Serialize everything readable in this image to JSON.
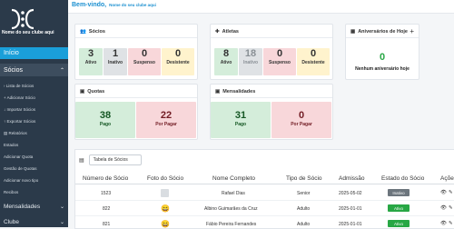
{
  "app": {
    "club_name": "Nome do seu clube aqui"
  },
  "sidebar": {
    "inicio": "Início",
    "socios": "Sócios",
    "socios_sub": [
      "Lista de Sócios",
      "Adicionar Sócio",
      "Importar Sócios",
      "Exportar Sócios",
      "Relatórios",
      "Estados",
      "Adicionar Quota",
      "Gestão de Quotas",
      "Adicionar novo tipo",
      "Recibos"
    ],
    "mensalidades": "Mensalidades",
    "clube": "Clube"
  },
  "header": {
    "welcome": "Bem-vindo,",
    "club": "Nome do seu clube aqui"
  },
  "socios_card": {
    "title": "Sócios",
    "stats": [
      {
        "value": "3",
        "label": "Ativo",
        "color": "#d4edda"
      },
      {
        "value": "1",
        "label": "Inativo",
        "color": "#dfe2e5"
      },
      {
        "value": "0",
        "label": "Suspenso",
        "color": "#f8d7da"
      },
      {
        "value": "0",
        "label": "Desistente",
        "color": "#fff3cd"
      }
    ]
  },
  "atletas_card": {
    "title": "Atletas",
    "stats": [
      {
        "value": "8",
        "label": "Ativo",
        "color": "#d4edda"
      },
      {
        "value": "18",
        "label": "Inativo",
        "color": "#dfe2e5"
      },
      {
        "value": "0",
        "label": "Suspenso",
        "color": "#f8d7da"
      },
      {
        "value": "0",
        "label": "Desistente",
        "color": "#fff3cd"
      }
    ]
  },
  "aniversarios_card": {
    "title": "Aniversários de Hoje",
    "count": "0",
    "text": "Nenhum aniversário hoje"
  },
  "quotas_card": {
    "title": "Quotas",
    "pago_value": "38",
    "pago_label": "Pago",
    "porpagar_value": "22",
    "porpagar_label": "Por Pagar"
  },
  "mensalidades_card": {
    "title": "Mensalidades",
    "pago_value": "31",
    "pago_label": "Pago",
    "porpagar_value": "0",
    "porpagar_label": "Por Pagar"
  },
  "table": {
    "select_value": "Tabela de Sócios",
    "headers": [
      "Número de Sócio",
      "Foto do Sócio",
      "Nome Completo",
      "Tipo de Sócio",
      "Admissão",
      "Estado do Sócio",
      "Açõe"
    ],
    "rows": [
      {
        "numero": "1523",
        "nome": "Rafael Dias",
        "tipo": "Senior",
        "admissao": "2025-05-02",
        "estado": "Inativo",
        "estado_color": "#6c757d"
      },
      {
        "numero": "822",
        "nome": "Albino Guimarães da Cruz",
        "tipo": "Adulto",
        "admissao": "2025-01-01",
        "estado": "Ativo",
        "estado_color": "#28a745"
      },
      {
        "numero": "821",
        "nome": "Fábio Pereira Fernandes",
        "tipo": "Adulto",
        "admissao": "2025-01-01",
        "estado": "Ativo",
        "estado_color": "#28a745"
      }
    ]
  }
}
